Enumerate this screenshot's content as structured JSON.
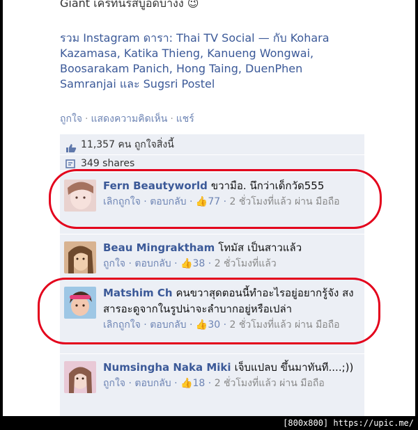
{
  "post": {
    "cut_line": "Giant เครทิ่นรสบูอดบางง 😉",
    "instagram_text": "รวม Instagram ดารา: Thai TV Social — กับ Kohara Kazamasa, Katika Thieng, Kanueng Wongwai, Boosarakam Panich, Hong Taing, DuenPhen Samranjai และ Sugsri Postel",
    "actions": {
      "like": "ถูกใจ",
      "comment": "แสดงความคิดเห็น",
      "share": "แชร์",
      "separator": "·"
    }
  },
  "summary": {
    "likes_text": "11,357 คน ถูกใจสิ่งนี้",
    "shares_text": "349 shares"
  },
  "comments": [
    {
      "name": "Fern Beautyworld",
      "text": "ขวามือ. นึกว่าเด็กวัด555",
      "like_action": "เลิกถูกใจ",
      "reply": "ตอบกลับ",
      "likes": "77",
      "time": "2 ชั่วโมงที่แล้ว ผ่าน มือถือ"
    },
    {
      "name": "Beau Mingraktham",
      "text": "โทมัส เป็นสาวแล้ว",
      "like_action": "ถูกใจ",
      "reply": "ตอบกลับ",
      "likes": "38",
      "time": "2 ชั่วโมงที่แล้ว"
    },
    {
      "name": "Matshim Ch",
      "text": "คนขวาสุดตอนนี้ทำอะไรอยู่อยากรู้จัง สงสารอะดูจากในรูปน่าจะลำบากอยู่หรือเปล่า",
      "like_action": "เลิกถูกใจ",
      "reply": "ตอบกลับ",
      "likes": "30",
      "time": "2 ชั่วโมงที่แล้ว ผ่าน มือถือ"
    },
    {
      "name": "Numsingha Naka Miki",
      "text": "เจ็บแปลบ ขึ้นมาทันที....;))",
      "like_action": "ถูกใจ",
      "reply": "ตอบกลับ",
      "likes": "18",
      "time": "2 ชั่วโมงที่แล้ว ผ่าน มือถือ"
    }
  ],
  "watermark": "[800x800] https://upic.me/",
  "colors": {
    "link": "#3b5998",
    "meta": "#6d84b4",
    "feedback_bg": "#eceff5",
    "annotation": "#e3001b"
  },
  "icons": {
    "like": "thumbs-up-icon",
    "share": "share-icon",
    "comment_like": "thumbs-up-icon"
  }
}
